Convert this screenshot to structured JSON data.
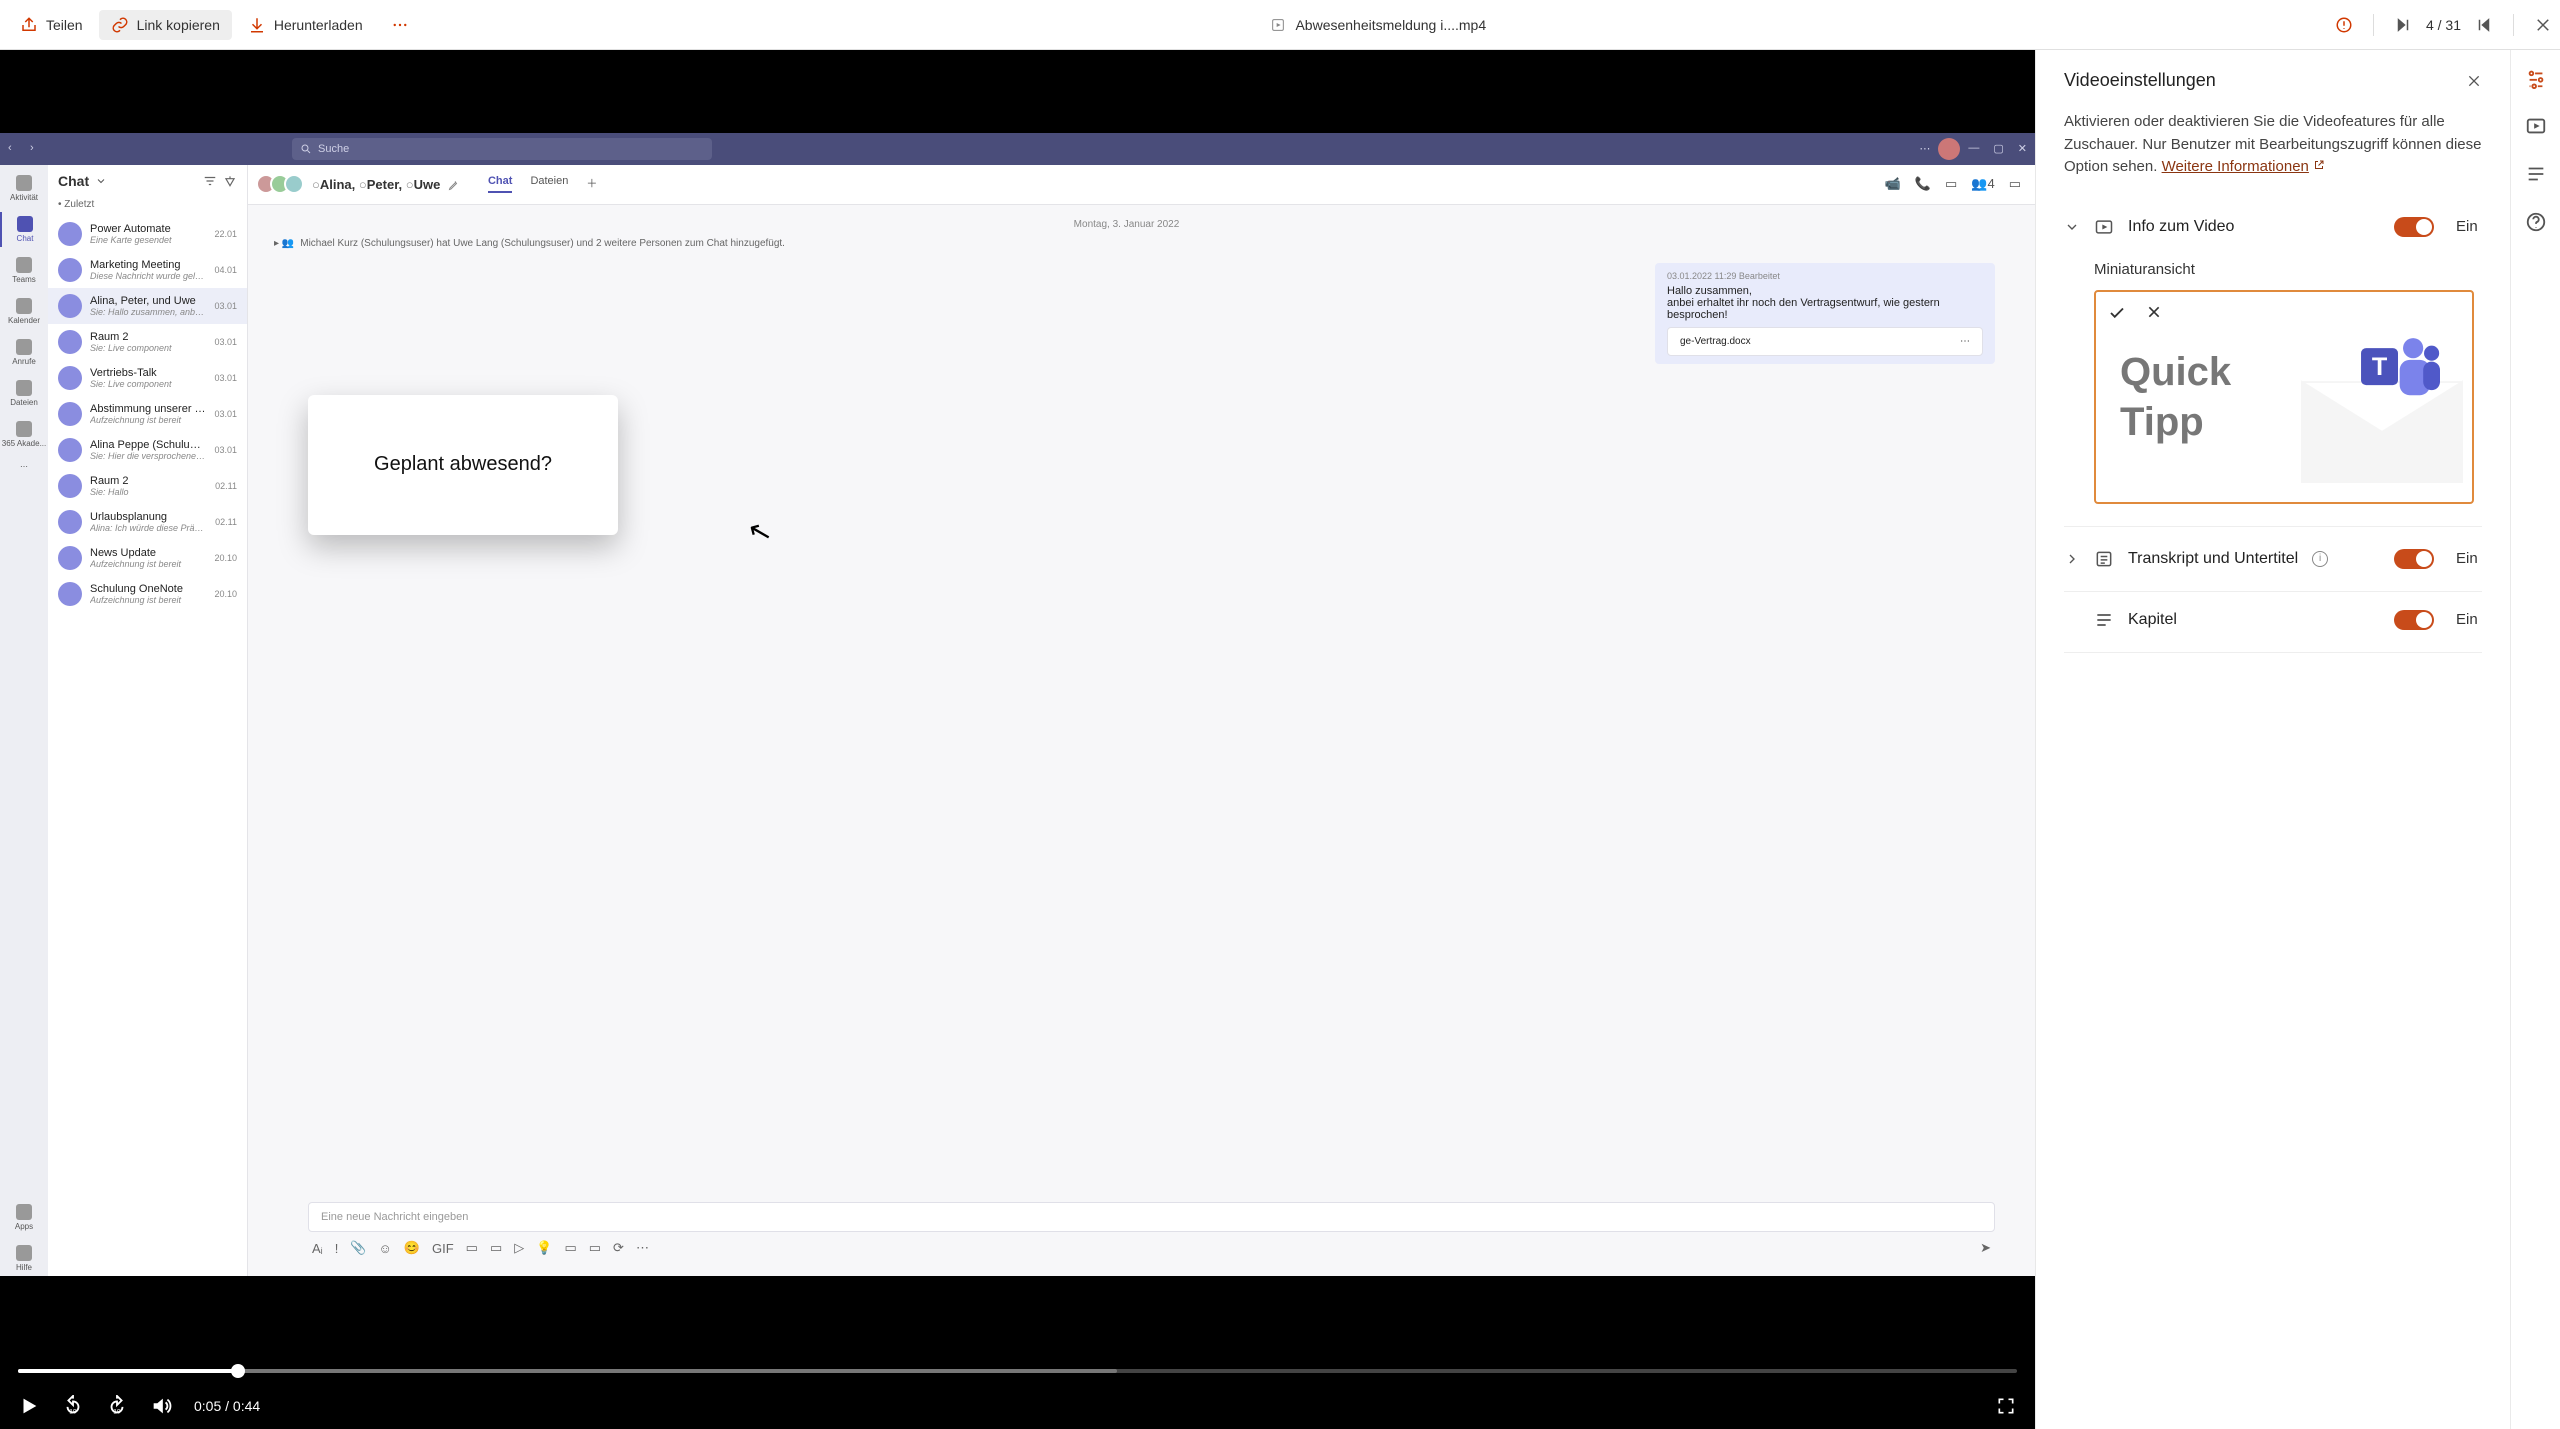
{
  "toolbar": {
    "share": "Teilen",
    "copy_link": "Link kopieren",
    "download": "Herunterladen",
    "file_name": "Abwesenheitsmeldung i....mp4",
    "page_indicator": "4 / 31"
  },
  "playback": {
    "current": "0:05",
    "duration": "0:44"
  },
  "settings": {
    "title": "Videoeinstellungen",
    "description_pre": "Aktivieren oder deaktivieren Sie die Videofeatures für alle Zuschauer. Nur Benutzer mit Bearbeitungszugriff können diese Option sehen. ",
    "learn_more": "Weitere Informationen",
    "rows": {
      "about_video": "Info zum Video",
      "thumbnail_label": "Miniaturansicht",
      "thumb_text_1": "Quick",
      "thumb_text_2": "Tipp",
      "transcript": "Transkript und Untertitel",
      "chapters": "Kapitel"
    },
    "toggle_on": "Ein"
  },
  "teams": {
    "search_placeholder": "Suche",
    "rail": [
      "Aktivität",
      "Chat",
      "Teams",
      "Kalender",
      "Anrufe",
      "Dateien",
      "365 Akade..."
    ],
    "rail_bottom": [
      "Apps",
      "Hilfe"
    ],
    "list_header": "Chat",
    "list_sub": "Zuletzt",
    "chats": [
      {
        "title": "Power Automate",
        "sub": "Eine Karte gesendet",
        "date": "22.01"
      },
      {
        "title": "Marketing Meeting",
        "sub": "Diese Nachricht wurde gelöscht",
        "date": "04.01"
      },
      {
        "title": "Alina, Peter, und Uwe",
        "sub": "Sie: Hallo zusammen, anbei erhal...",
        "date": "03.01"
      },
      {
        "title": "Raum 2",
        "sub": "Sie: Live component",
        "date": "03.01"
      },
      {
        "title": "Vertriebs-Talk",
        "sub": "Sie: Live component",
        "date": "03.01"
      },
      {
        "title": "Abstimmung unserer neu...",
        "sub": "Aufzeichnung ist bereit",
        "date": "03.01"
      },
      {
        "title": "Alina Peppe (Schulungsu...",
        "sub": "Sie: Hier die versprochene Präsen...",
        "date": "03.01"
      },
      {
        "title": "Raum 2",
        "sub": "Sie: Hallo",
        "date": "02.11"
      },
      {
        "title": "Urlaubsplanung",
        "sub": "Alina: Ich würde diese Präsentati...",
        "date": "02.11"
      },
      {
        "title": "News Update",
        "sub": "Aufzeichnung ist bereit",
        "date": "20.10"
      },
      {
        "title": "Schulung OneNote",
        "sub": "Aufzeichnung ist bereit",
        "date": "20.10"
      }
    ],
    "convo": {
      "title": "Alina, ",
      "title_2": "Peter, ",
      "title_3": "Uwe",
      "tab_chat": "Chat",
      "tab_files": "Dateien",
      "participants": "4",
      "date_sep": "Montag, 3. Januar 2022",
      "notice": "Michael Kurz (Schulungsuser) hat Uwe Lang (Schulungsuser) und 2 weitere Personen zum Chat hinzugefügt.",
      "msg_meta": "03.01.2022 11:29    Bearbeitet",
      "msg_line1": "Hallo zusammen,",
      "msg_line2": "anbei erhaltet ihr noch den Vertragsentwurf, wie gestern besprochen!",
      "attach": "ge-Vertrag.docx",
      "compose_placeholder": "Eine neue Nachricht eingeben",
      "card": "Geplant abwesend?"
    }
  }
}
